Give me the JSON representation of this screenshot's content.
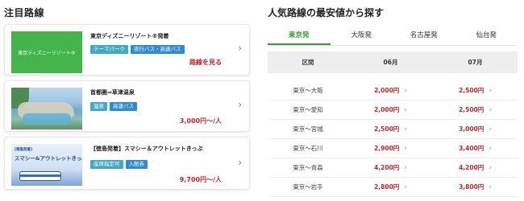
{
  "left": {
    "title": "注目路線",
    "cards": [
      {
        "thumb_text": "東京ディズニーリゾート®",
        "title": "東京ディズニーリゾート®発着",
        "tags": [
          "テーマパーク",
          "夜行バス・高速バス"
        ],
        "price": "路線を見る"
      },
      {
        "title": "首都圏⇒草津温泉",
        "tags": [
          "温泉",
          "高速バス"
        ],
        "price": "3,000円〜/人"
      },
      {
        "thumb_text_small": "[徳島発着]",
        "thumb_text": "スマシー&アウトレットきっぷ",
        "title": "【徳島発着】スマシー＆アウトレットきっぷ",
        "tags": [
          "座席指定可",
          "入館券"
        ],
        "price": "9,700円〜/人"
      }
    ]
  },
  "right": {
    "title": "人気路線の最安値から探す",
    "tabs": [
      "東京発",
      "大阪発",
      "名古屋発",
      "仙台発"
    ],
    "active_tab": 0,
    "headers": [
      "区間",
      "06月",
      "07月"
    ],
    "rows": [
      [
        "東京〜大阪",
        "2,000円",
        "2,500円"
      ],
      [
        "東京〜愛知",
        "2,000円",
        "2,500円"
      ],
      [
        "東京〜宮城",
        "2,500円",
        "3,000円"
      ],
      [
        "東京〜石川",
        "2,900円",
        "3,400円"
      ],
      [
        "東京〜青森",
        "4,200円",
        "4,200円"
      ],
      [
        "東京〜岩手",
        "2,800円",
        "3,800円"
      ]
    ]
  },
  "colors": {
    "accent_green": "#3a9b3a",
    "price_red": "#c8242b",
    "tag_teal": "#3fa9c6",
    "tag_blue": "#2d8ad8"
  },
  "icons": [
    "chevron-right-icon"
  ]
}
